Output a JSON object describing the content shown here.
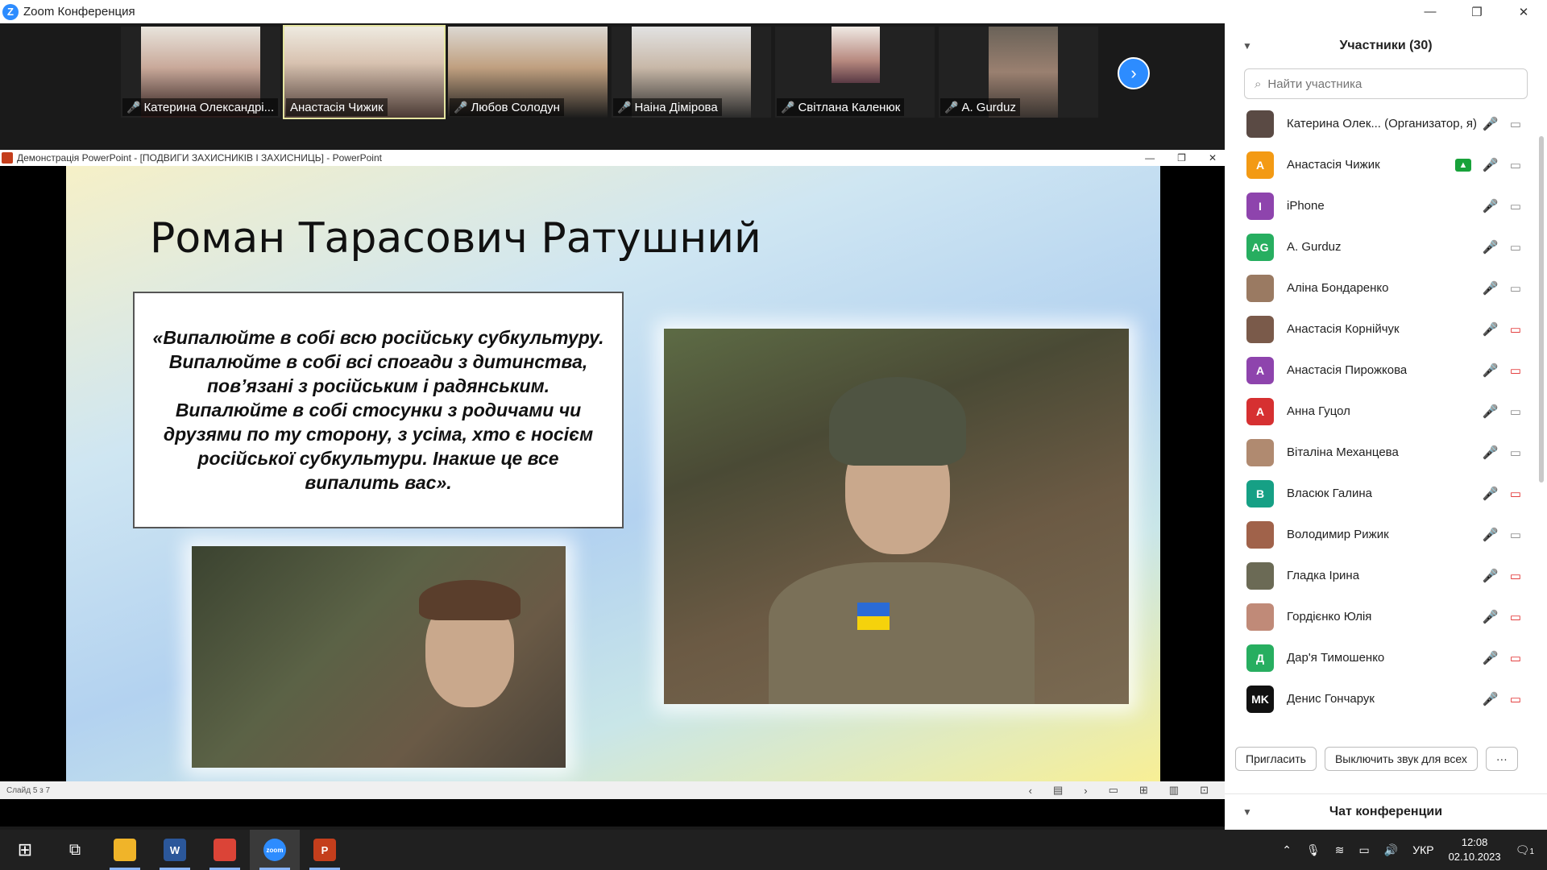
{
  "window": {
    "title": "Zoom Конференция",
    "controls": [
      "—",
      "❐",
      "✕"
    ]
  },
  "video_strip": {
    "tiles": [
      {
        "name": "Катерина Олександрі...",
        "muted": true
      },
      {
        "name": "Анастасія Чижик",
        "muted": false
      },
      {
        "name": "Любов Солодун",
        "muted": true
      },
      {
        "name": "Наіна Дімірова",
        "muted": true
      },
      {
        "name": "Світлана Каленюк",
        "muted": true
      },
      {
        "name": "A. Gurduz",
        "muted": true
      }
    ],
    "next_icon": "chevron-right-icon"
  },
  "ppt": {
    "window_title": "Демонстрація PowerPoint - [ПОДВИГИ ЗАХИСНИКІВ І ЗАХИСНИЦЬ] - PowerPoint",
    "slide_title": "Роман Тарасович Ратушний",
    "quote": "«Випалюйте в собі всю російську субкультуру. Випалюйте в собі всі спогади з дитинства, пов’язані з російським і радянським. Випалюйте в собі стосунки з родичами чи друзями по ту сторону, з усіма, хто є носієм російської субкультури. Інакше це все випалить вас».",
    "status": "Слайд 5 з 7"
  },
  "participants_panel": {
    "title": "Участники (30)",
    "search_placeholder": "Найти участника",
    "participants": [
      {
        "name": "Катерина Олек... (Организатор, я)",
        "avatar_text": "",
        "avatar_color": "#5a4a44",
        "mic_muted": true,
        "cam_off": false,
        "sharing": false
      },
      {
        "name": "Анастасія Чижик",
        "avatar_text": "А",
        "avatar_color": "#f39a14",
        "mic_muted": false,
        "cam_off": false,
        "sharing": true
      },
      {
        "name": "iPhone",
        "avatar_text": "I",
        "avatar_color": "#8e44ad",
        "mic_muted": false,
        "cam_off": false,
        "sharing": false
      },
      {
        "name": "A. Gurduz",
        "avatar_text": "AG",
        "avatar_color": "#27ae60",
        "mic_muted": true,
        "cam_off": false,
        "sharing": false
      },
      {
        "name": "Аліна Бондаренко",
        "avatar_text": "",
        "avatar_color": "#9a7a62",
        "mic_muted": true,
        "cam_off": false,
        "sharing": false
      },
      {
        "name": "Анастасія Корнійчук",
        "avatar_text": "",
        "avatar_color": "#7a5a4a",
        "mic_muted": true,
        "cam_off": true,
        "sharing": false
      },
      {
        "name": "Анастасія Пирожкова",
        "avatar_text": "А",
        "avatar_color": "#8e44ad",
        "mic_muted": true,
        "cam_off": true,
        "sharing": false
      },
      {
        "name": "Анна Гуцол",
        "avatar_text": "А",
        "avatar_color": "#d63031",
        "mic_muted": true,
        "cam_off": false,
        "sharing": false
      },
      {
        "name": "Віталіна Механцева",
        "avatar_text": "",
        "avatar_color": "#b08a70",
        "mic_muted": true,
        "cam_off": false,
        "sharing": false
      },
      {
        "name": "Власюк Галина",
        "avatar_text": "В",
        "avatar_color": "#16a085",
        "mic_muted": true,
        "cam_off": true,
        "sharing": false
      },
      {
        "name": "Володимир Рижик",
        "avatar_text": "",
        "avatar_color": "#a0624a",
        "mic_muted": true,
        "cam_off": false,
        "sharing": false
      },
      {
        "name": "Гладка Ірина",
        "avatar_text": "",
        "avatar_color": "#6b6a55",
        "mic_muted": true,
        "cam_off": true,
        "sharing": false
      },
      {
        "name": "Гордієнко Юлія",
        "avatar_text": "",
        "avatar_color": "#c08a78",
        "mic_muted": true,
        "cam_off": true,
        "sharing": false
      },
      {
        "name": "Дар'я Тимошенко",
        "avatar_text": "Д",
        "avatar_color": "#27ae60",
        "mic_muted": true,
        "cam_off": true,
        "sharing": false
      },
      {
        "name": "Денис Гончарук",
        "avatar_text": "MK",
        "avatar_color": "#111111",
        "mic_muted": true,
        "cam_off": true,
        "sharing": false
      }
    ],
    "invite_label": "Пригласить",
    "mute_all_label": "Выключить звук для всех",
    "more_label": "···",
    "chat_title": "Чат конференции"
  },
  "taskbar": {
    "lang": "УКР",
    "time": "12:08",
    "date": "02.10.2023",
    "notifications": "1",
    "apps": [
      {
        "name": "file-explorer-icon",
        "label": "",
        "color": "#f0b429"
      },
      {
        "name": "word-icon",
        "label": "W",
        "color": "#2b579a"
      },
      {
        "name": "chrome-icon",
        "label": "",
        "color": "#db4437"
      },
      {
        "name": "zoom-icon",
        "label": "zoom",
        "color": "#2d8cff"
      },
      {
        "name": "powerpoint-icon",
        "label": "P",
        "color": "#c43e1c"
      }
    ]
  }
}
